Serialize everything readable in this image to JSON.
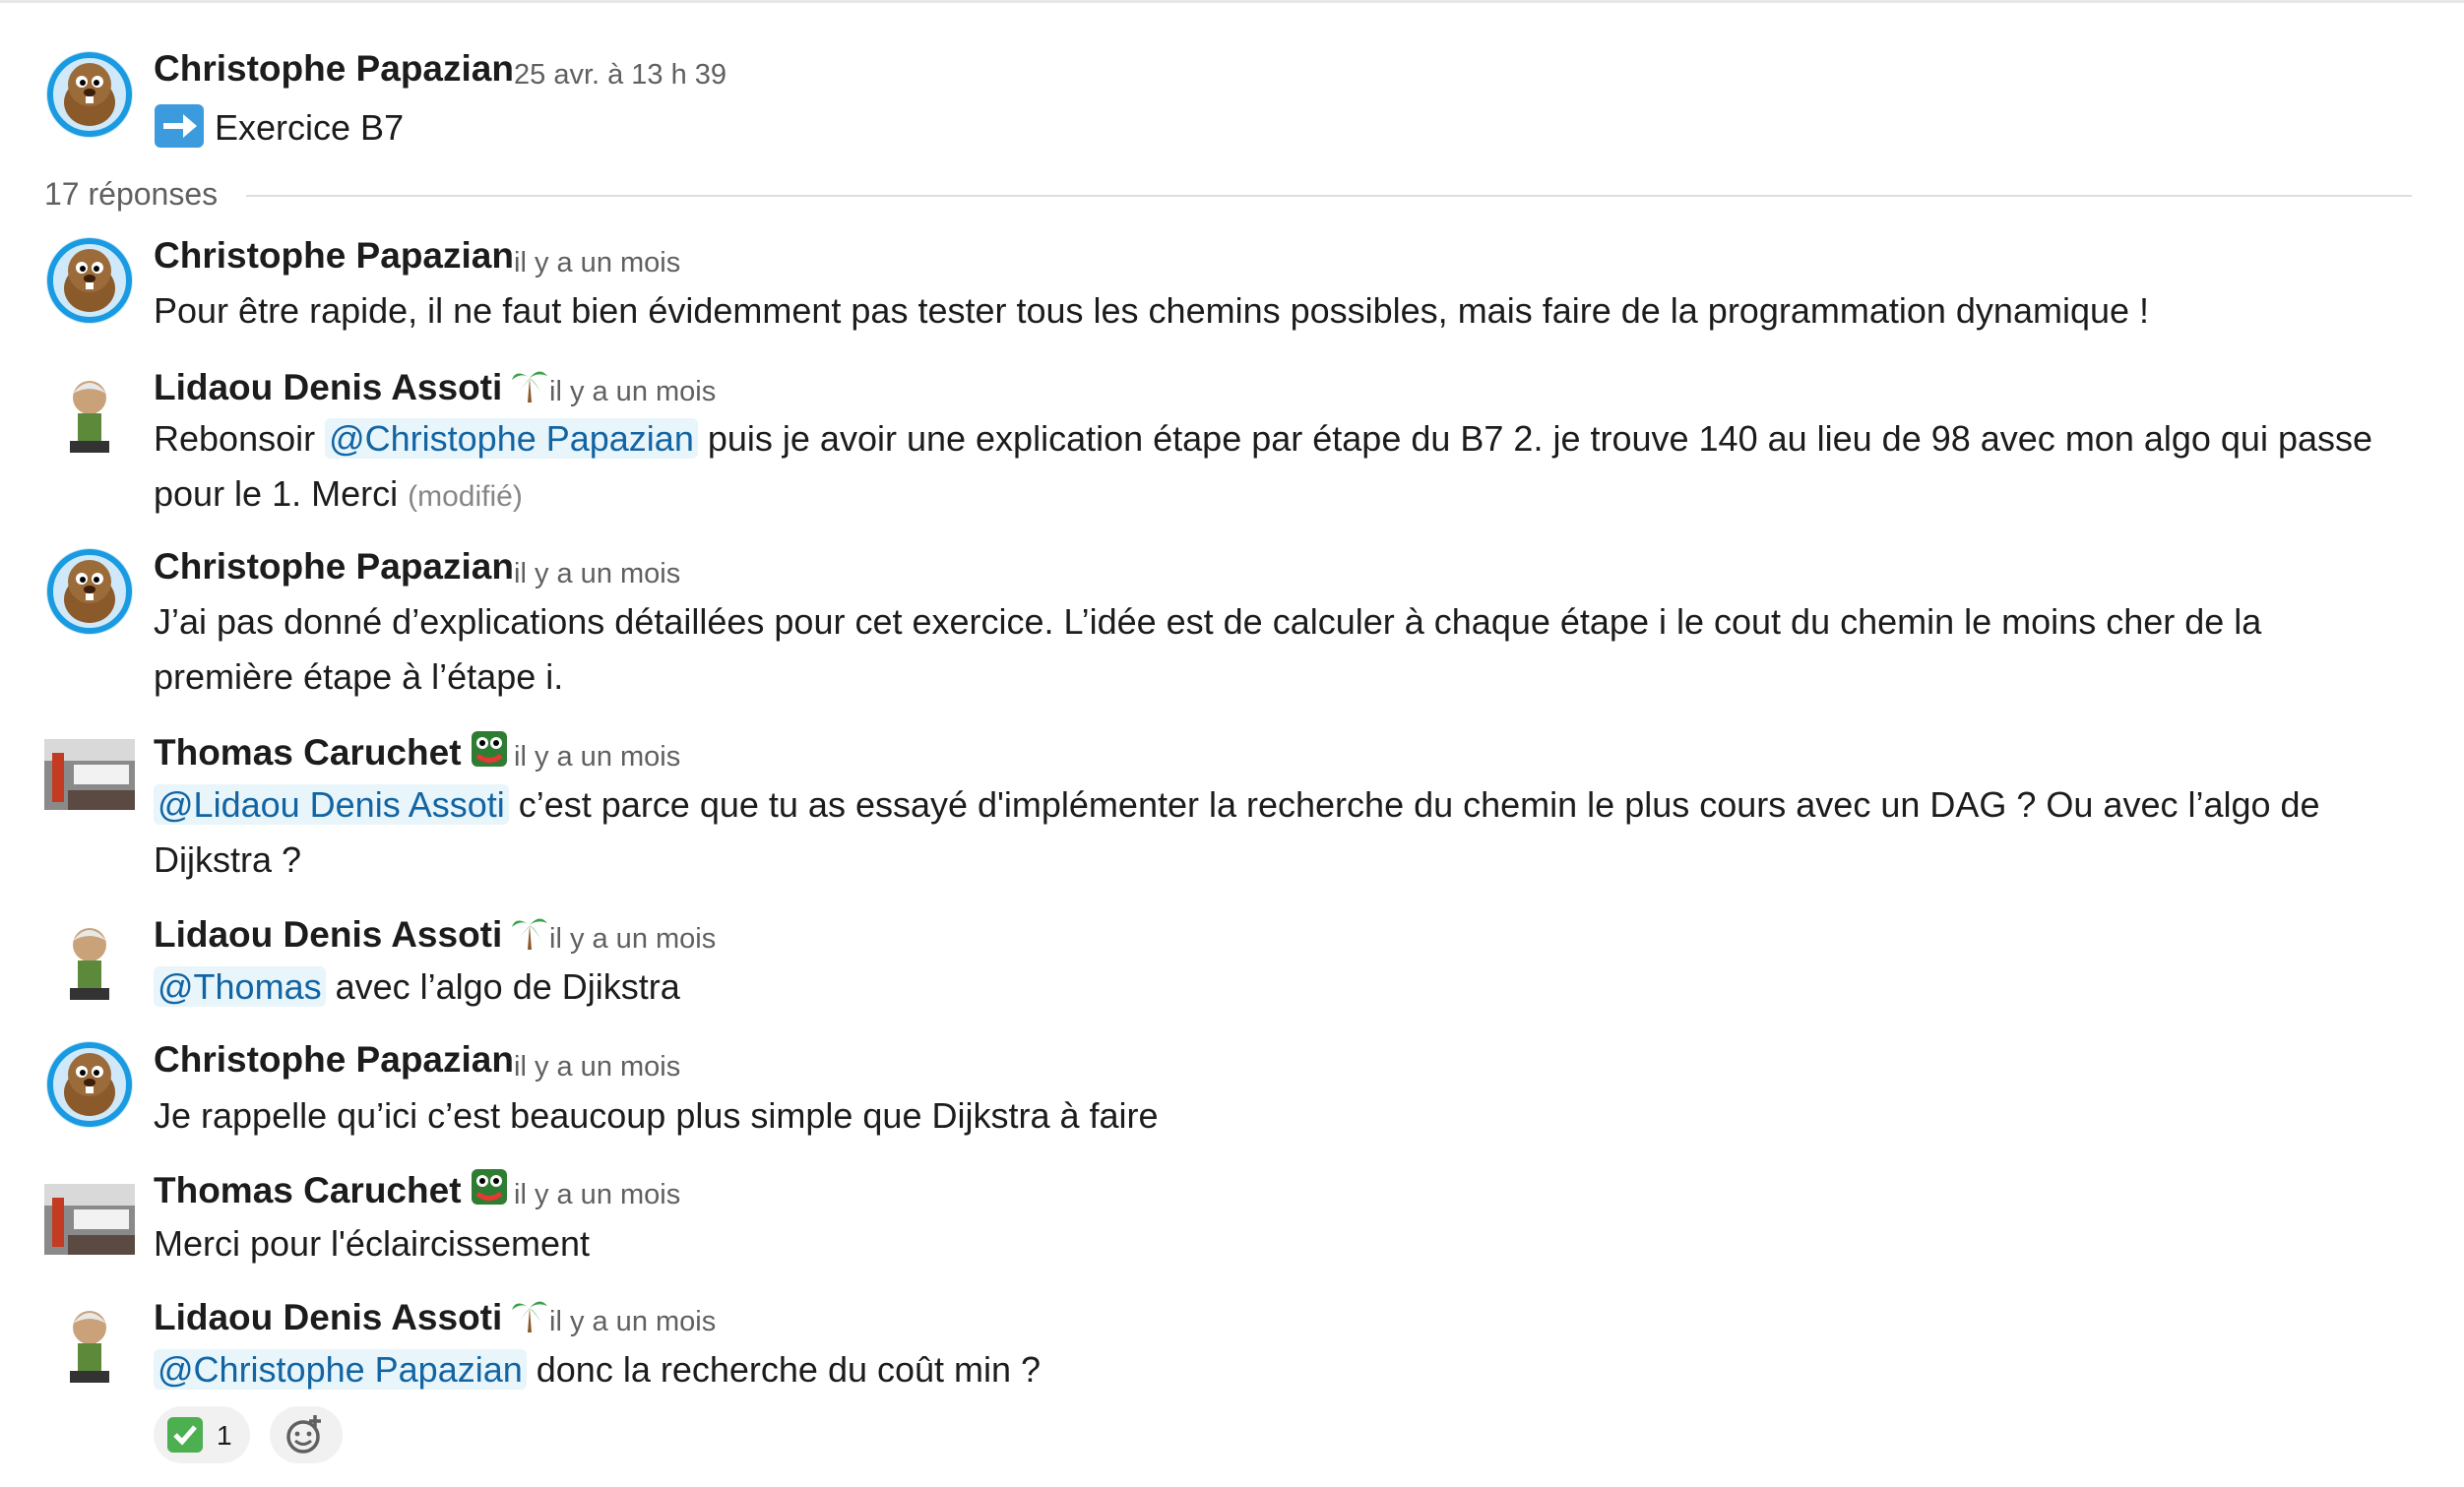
{
  "thread": {
    "parent": {
      "author": "Christophe Papazian",
      "time": "25 avr. à 13 h 39",
      "text": "Exercice B7",
      "icon": "arrow-right-emoji"
    },
    "replies_label": "17 réponses",
    "messages": [
      {
        "author": "Christophe Papazian",
        "time": "il y a un mois",
        "lines": [
          "Pour être rapide, il ne faut bien évidemment pas tester tous les chemins possibles, mais faire de la programmation dynamique !"
        ]
      },
      {
        "author": "Lidaou Denis Assoti",
        "status_emoji": "palm-tree-icon",
        "time": "il y a un mois",
        "line1_pre": "Rebonsoir ",
        "line1_mention": "@Christophe Papazian",
        "line1_post": " puis je avoir une explication étape par étape du B7 2. je trouve 140 au lieu de 98 avec mon algo qui passe",
        "line2": "pour le 1. Merci",
        "edited": "(modifié)"
      },
      {
        "author": "Christophe Papazian",
        "time": "il y a un mois",
        "line1": "J’ai pas donné d’explications détaillées pour cet exercice. L’idée est de calculer à chaque étape i le cout du chemin le moins cher de la",
        "line2": "première étape à l’étape i."
      },
      {
        "author": "Thomas Caruchet",
        "status_emoji": "frog-icon",
        "time": "il y a un mois",
        "line1_mention": "@Lidaou Denis Assoti",
        "line1_post": " c’est parce que tu as essayé d'implémenter la recherche du chemin le plus cours avec un DAG ? Ou avec l’algo de",
        "line2": "Dijkstra ?"
      },
      {
        "author": "Lidaou Denis Assoti",
        "status_emoji": "palm-tree-icon",
        "time": "il y a un mois",
        "mention": "@Thomas",
        "post": " avec l’algo de Djikstra"
      },
      {
        "author": "Christophe Papazian",
        "time": "il y a un mois",
        "text": "Je rappelle qu’ici c’est beaucoup plus simple que Dijkstra à faire"
      },
      {
        "author": "Thomas Caruchet",
        "status_emoji": "frog-icon",
        "time": "il y a un mois",
        "text": "Merci pour l'éclaircissement"
      },
      {
        "author": "Lidaou Denis Assoti",
        "status_emoji": "palm-tree-icon",
        "time": "il y a un mois",
        "mention": "@Christophe Papazian",
        "post": " donc la recherche du coût min ?",
        "reaction": {
          "emoji": "white-check-mark-icon",
          "count": "1"
        }
      }
    ]
  },
  "colors": {
    "mention_bg": "#e8f5fa",
    "mention_text": "#1264a3",
    "timestamp": "#616061",
    "reaction_bg": "#f1f1f1",
    "check_green": "#4caf50",
    "rule": "#dddddd"
  }
}
